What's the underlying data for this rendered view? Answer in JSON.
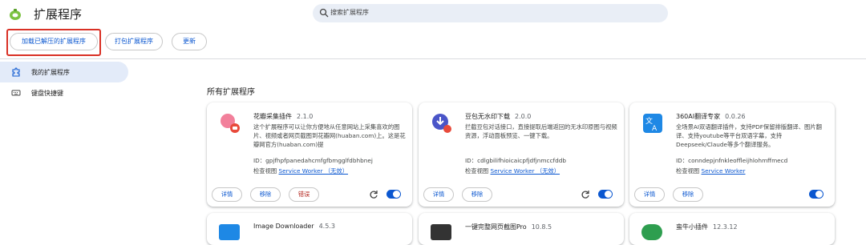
{
  "header": {
    "title": "扩展程序",
    "search_placeholder": "搜索扩展程序"
  },
  "toolbar": {
    "load_unpacked": "加载已解压的扩展程序",
    "pack": "打包扩展程序",
    "update": "更新"
  },
  "sidebar": {
    "items": [
      {
        "label": "我的扩展程序",
        "icon": "puzzle-icon",
        "active": true
      },
      {
        "label": "键盘快捷键",
        "icon": "keyboard-icon",
        "active": false
      }
    ]
  },
  "main": {
    "section_title": "所有扩展程序"
  },
  "labels": {
    "details": "详情",
    "remove": "移除",
    "errors": "错误",
    "inspect_views": "检查视图"
  },
  "extensions": [
    {
      "name": "花瓣采集插件",
      "version": "2.1.0",
      "description": "这个扩展程序可以让你方便地从任意网站上采集喜欢的图片、视频或者网页截图到花瓣网(huaban.com)上。这是花瓣网官方(huaban.com)提",
      "id": "ID：gpjfhpfpanedahcmfgfbmgglfdbhbnej",
      "view": "Service Worker （无效）",
      "enabled": true
    },
    {
      "name": "豆包无水印下载",
      "version": "2.0.0",
      "description": "拦截豆包对话接口，直接提取后端返回的无水印原图与视频资源，浮动面板预览、一键下载。",
      "id": "ID：cdlgbilifhioicaicpfjdfjnmccfddb",
      "view": "Service Worker （无效）",
      "enabled": true
    },
    {
      "name": "360AI翻译专家",
      "version": "0.0.26",
      "description": "全场景AI双语翻译插件，支持PDF保留排版翻译、图片翻译、支持youtube等平台双语字幕，支持Deepseek/Claude等多个翻译服务。",
      "id": "ID：conndepjnfnkleoffleijhlohmffmecd",
      "view": "Service Worker",
      "enabled": true
    },
    {
      "name": "Image Downloader",
      "version": "4.5.3"
    },
    {
      "name": "一键完整网页截图Pro",
      "version": "10.8.5"
    },
    {
      "name": "蛮牛小插件",
      "version": "12.3.12"
    }
  ],
  "colors": {
    "accent": "#0b57d0",
    "error": "#b3261e",
    "highlight": "#d93025",
    "active_nav_bg": "#e3ebf9"
  }
}
